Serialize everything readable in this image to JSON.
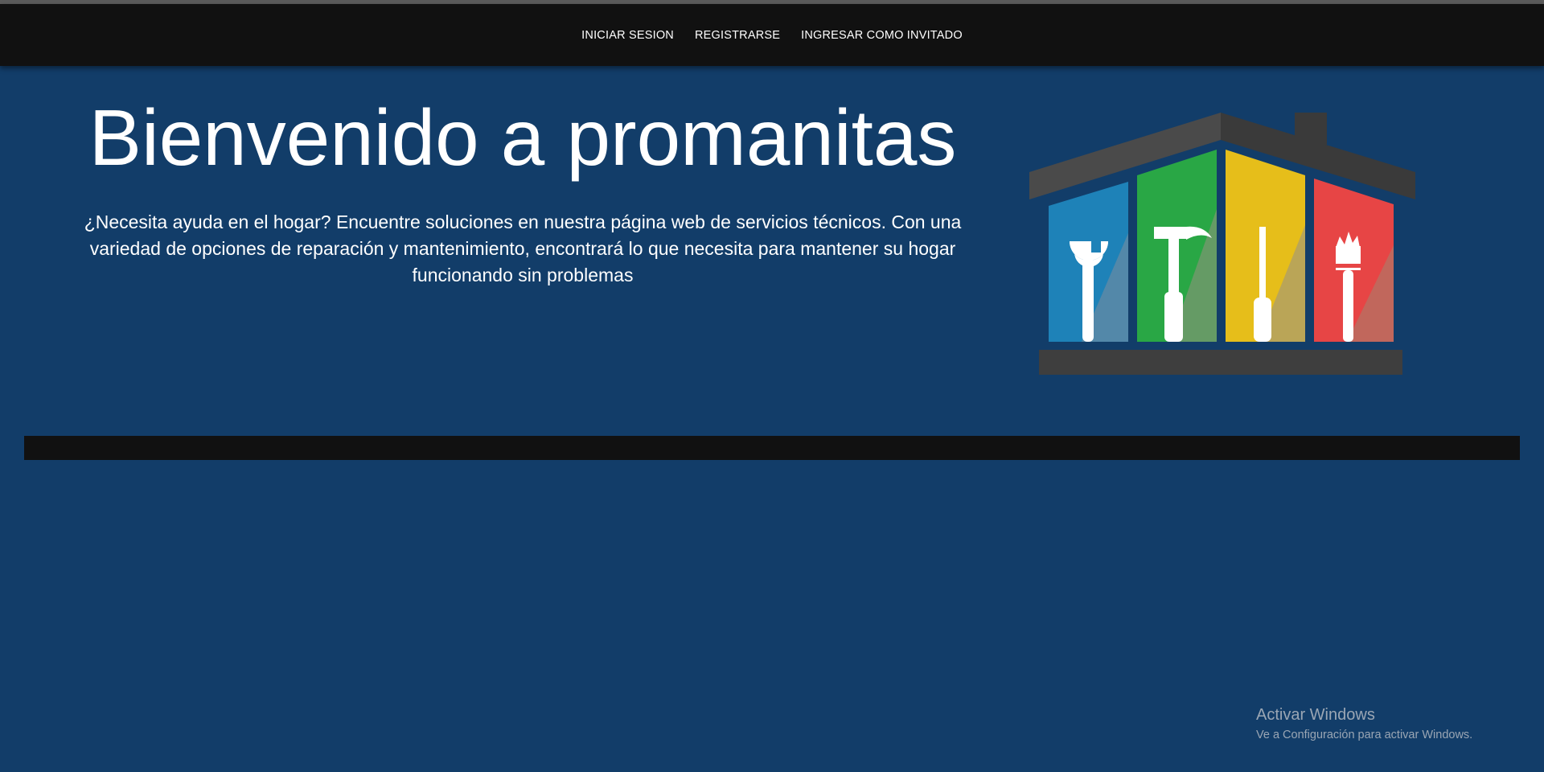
{
  "nav": {
    "items": [
      {
        "label": "INICIAR SESION"
      },
      {
        "label": "REGISTRARSE"
      },
      {
        "label": "INGRESAR COMO INVITADO"
      }
    ]
  },
  "hero": {
    "title": "Bienvenido a promanitas",
    "description": "¿Necesita ayuda en el hogar? Encuentre soluciones en nuestra página web de servicios técnicos. Con una variedad de opciones de reparación y mantenimiento, encontrará lo que necesita para mantener su hogar funcionando sin problemas"
  },
  "logo": {
    "icon": "house-tools-logo",
    "panel_colors": [
      "#1e82b8",
      "#29a745",
      "#e6be1a",
      "#e74545"
    ],
    "roof_color": "#444444"
  },
  "watermark": {
    "title": "Activar Windows",
    "subtitle": "Ve a Configuración para activar Windows."
  },
  "colors": {
    "background": "#123d69",
    "navbar": "#111111"
  }
}
